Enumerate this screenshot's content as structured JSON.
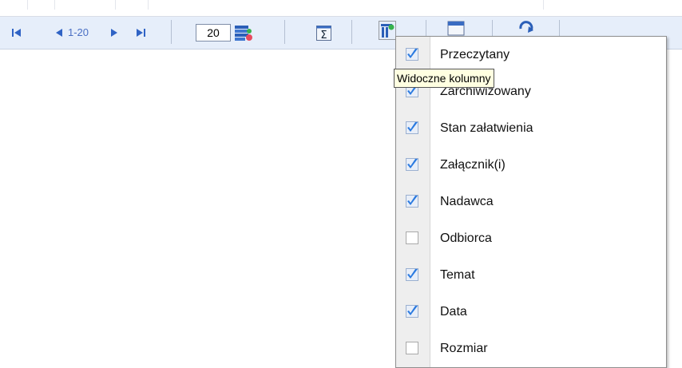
{
  "pager": {
    "first_icon": "first-page-icon",
    "prev_icon": "prev-page-icon",
    "range": "1-20",
    "next_icon": "next-page-icon",
    "last_icon": "last-page-icon",
    "page_size": "20"
  },
  "toolbar": {
    "page_size_options_icon": "rows-per-page-icon",
    "sum_icon": "sigma-icon",
    "columns_icon": "visible-columns-icon",
    "calendar_icon": "calendar-icon",
    "refresh_icon": "refresh-icon"
  },
  "tooltip": {
    "text": "Widoczne kolumny"
  },
  "columns_menu": {
    "items": [
      {
        "label": "Przeczytany",
        "checked": true
      },
      {
        "label": "Zarchiwizowany",
        "checked": true
      },
      {
        "label": "Stan załatwienia",
        "checked": true
      },
      {
        "label": "Załącznik(i)",
        "checked": true
      },
      {
        "label": "Nadawca",
        "checked": true
      },
      {
        "label": "Odbiorca",
        "checked": false
      },
      {
        "label": "Temat",
        "checked": true
      },
      {
        "label": "Data",
        "checked": true
      },
      {
        "label": "Rozmiar",
        "checked": false
      }
    ]
  },
  "colors": {
    "toolbar_bg": "#e6eefa",
    "accent_blue": "#2f63c5",
    "check_blue": "#2a7ae0",
    "tooltip_bg": "#ffffe1"
  }
}
